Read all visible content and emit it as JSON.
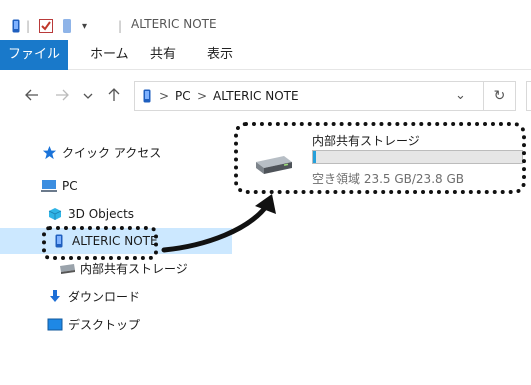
{
  "window": {
    "title": "ALTERIC NOTE",
    "title_separator": "|",
    "qa_separator": "|"
  },
  "ribbon": {
    "tabs": [
      {
        "label": "ファイル",
        "active": true
      },
      {
        "label": "ホーム"
      },
      {
        "label": "共有"
      },
      {
        "label": "表示"
      }
    ],
    "active_color": "#1979ca"
  },
  "address": {
    "path": [
      {
        "label": "PC"
      },
      {
        "label": "ALTERIC NOTE"
      }
    ],
    "separator": ">",
    "dropdown_glyph": "⌄",
    "refresh_glyph": "↻"
  },
  "navigation": {
    "items": [
      {
        "label": "クイック アクセス",
        "icon": "star-icon",
        "color": "#1a73d9"
      },
      {
        "label": "PC",
        "icon": "computer-icon"
      },
      {
        "label": "3D Objects",
        "icon": "3d-objects-icon"
      },
      {
        "label": "ALTERIC NOTE",
        "icon": "phone-icon",
        "selected": true
      },
      {
        "label": "内部共有ストレージ",
        "icon": "drive-icon"
      },
      {
        "label": "ダウンロード",
        "icon": "download-icon",
        "color": "#1e6fd6"
      },
      {
        "label": "デスクトップ",
        "icon": "desktop-icon",
        "color": "#1e88e5"
      }
    ]
  },
  "content": {
    "drive": {
      "name": "内部共有ストレージ",
      "space_text": "空き領域 23.5 GB/23.8 GB",
      "used_fraction": 0.013,
      "bar_color": "#26a0da"
    }
  }
}
